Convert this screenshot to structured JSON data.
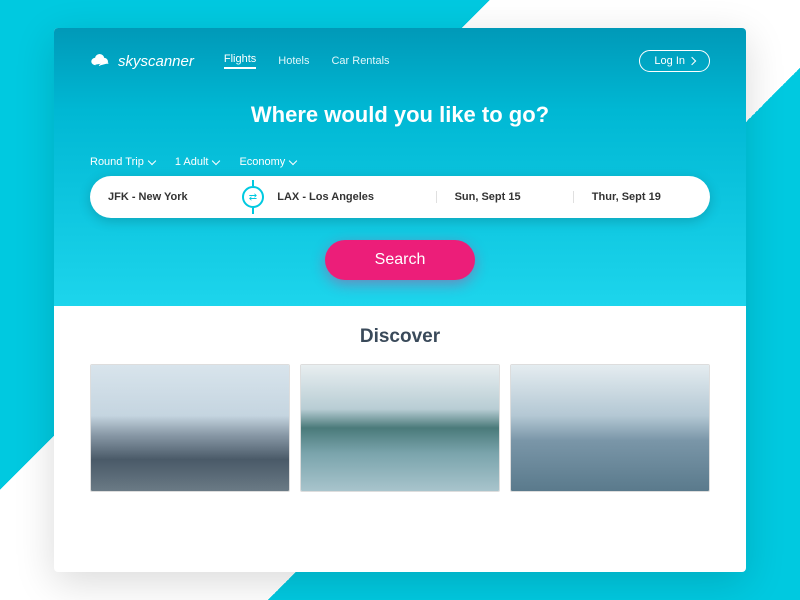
{
  "brand": "skyscanner",
  "nav": [
    "Flights",
    "Hotels",
    "Car Rentals"
  ],
  "login": "Log In",
  "title": "Where would you like to go?",
  "options": {
    "tripType": "Round Trip",
    "passengers": "1 Adult",
    "cabinClass": "Economy"
  },
  "search": {
    "from": "JFK - New York",
    "to": "LAX - Los Angeles",
    "depart": "Sun, Sept 15",
    "return": "Thur, Sept 19"
  },
  "searchLabel": "Search",
  "discover": {
    "title": "Discover",
    "tiles": [
      "mountain-road",
      "island-bay",
      "city-skyline"
    ]
  },
  "colors": {
    "primary": "#00c9e0",
    "accent": "#ec1e79"
  }
}
